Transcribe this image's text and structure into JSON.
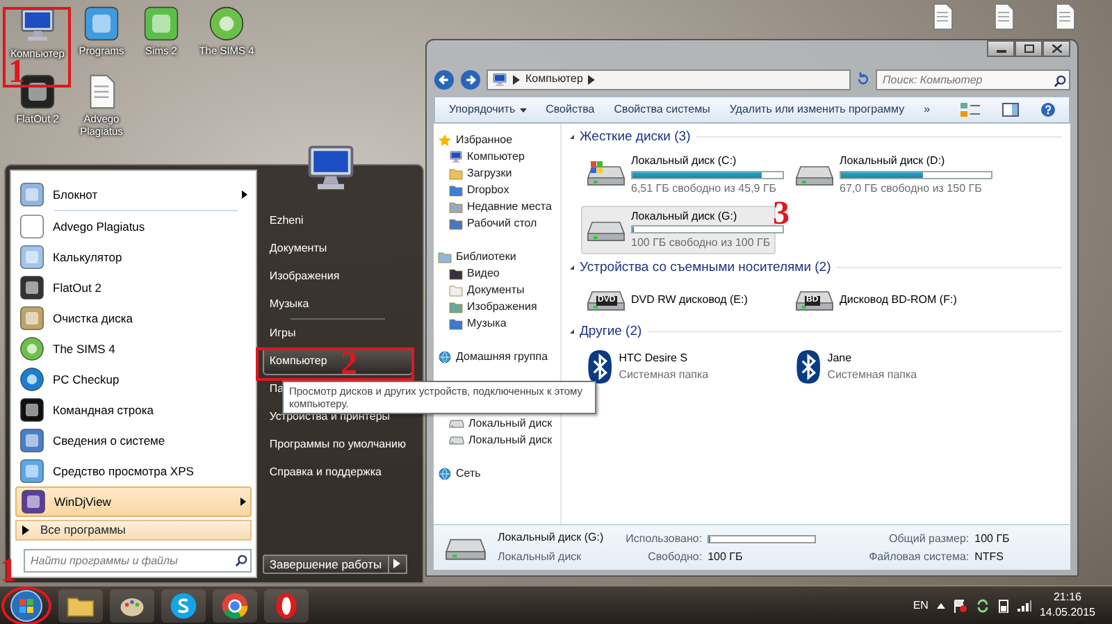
{
  "desktop_icons": [
    {
      "label": "Компьютер"
    },
    {
      "label": "Programs"
    },
    {
      "label": "Sims 2"
    },
    {
      "label": "The SIMS 4"
    },
    {
      "label": "FlatOut 2"
    },
    {
      "label": "Advego Plagiatus"
    }
  ],
  "annotations": [
    {
      "label": "1"
    },
    {
      "label": "1"
    },
    {
      "label": "2"
    },
    {
      "label": "3"
    }
  ],
  "start_menu": {
    "programs": [
      {
        "label": "Блокнот",
        "submenu": true,
        "selected": false
      },
      {
        "label": "Advego Plagiatus",
        "submenu": false,
        "selected": false
      },
      {
        "label": "Калькулятор",
        "submenu": false,
        "selected": false
      },
      {
        "label": "FlatOut 2",
        "submenu": false,
        "selected": false
      },
      {
        "label": "Очистка диска",
        "submenu": false,
        "selected": false
      },
      {
        "label": "The SIMS 4",
        "submenu": false,
        "selected": false
      },
      {
        "label": "PC Checkup",
        "submenu": false,
        "selected": false
      },
      {
        "label": "Командная строка",
        "submenu": false,
        "selected": false
      },
      {
        "label": "Сведения о системе",
        "submenu": false,
        "selected": false
      },
      {
        "label": "Средство просмотра XPS",
        "submenu": false,
        "selected": false
      },
      {
        "label": "WinDjView",
        "submenu": true,
        "selected": true
      }
    ],
    "all_programs": "Все программы",
    "search": {
      "placeholder": "Найти программы и файлы"
    },
    "places": [
      {
        "label": "Ezheni",
        "selected": false
      },
      {
        "label": "Документы",
        "selected": false
      },
      {
        "label": "Изображения",
        "selected": false
      },
      {
        "label": "Музыка",
        "selected": false
      },
      {
        "label": "Игры",
        "selected": false
      },
      {
        "label": "Компьютер",
        "selected": true
      },
      {
        "label": "Па",
        "selected": false
      },
      {
        "label": "Устройства и принтеры",
        "selected": false
      },
      {
        "label": "Программы по умолчанию",
        "selected": false
      },
      {
        "label": "Справка и поддержка",
        "selected": false
      }
    ],
    "shutdown": "Завершение работы"
  },
  "tooltip": "Просмотр дисков и других устройств, подключенных к этому компьютеру.",
  "explorer": {
    "breadcrumb": "Компьютер",
    "search": {
      "placeholder": "Поиск: Компьютер"
    },
    "toolbar": [
      {
        "label": "Упорядочить",
        "dropdown": true
      },
      {
        "label": "Свойства",
        "dropdown": false
      },
      {
        "label": "Свойства системы",
        "dropdown": false
      },
      {
        "label": "Удалить или изменить программу",
        "dropdown": false
      },
      {
        "label": "»",
        "dropdown": false
      }
    ],
    "nav": [
      {
        "label": "Избранное",
        "children": [
          {
            "label": "Компьютер"
          },
          {
            "label": "Загрузки"
          },
          {
            "label": "Dropbox"
          },
          {
            "label": "Недавние места"
          },
          {
            "label": "Рабочий стол"
          }
        ]
      },
      {
        "label": "Библиотеки",
        "children": [
          {
            "label": "Видео"
          },
          {
            "label": "Документы"
          },
          {
            "label": "Изображения"
          },
          {
            "label": "Музыка"
          }
        ]
      },
      {
        "label": "Домашняя группа"
      },
      {
        "children": [
          {
            "label": "Локальный диск"
          },
          {
            "label": "Локальный диск"
          }
        ]
      },
      {
        "label": "Сеть"
      }
    ],
    "sections": [
      {
        "title": "Жесткие диски (3)",
        "items": [
          {
            "kind": "disk",
            "name": "Локальный диск (C:)",
            "level": 0.86,
            "reading": "6,51 ГБ свободно из 45,9 ГБ",
            "selected": false
          },
          {
            "kind": "disk",
            "name": "Локальный диск (D:)",
            "level": 0.55,
            "reading": "67,0 ГБ свободно из 150 ГБ",
            "selected": false
          },
          {
            "kind": "disk",
            "name": "Локальный диск (G:)",
            "level": 0,
            "reading": "100 ГБ свободно из 100 ГБ",
            "selected": true
          }
        ]
      },
      {
        "title": "Устройства со съемными носителями (2)",
        "items": [
          {
            "kind": "optical",
            "name": "DVD RW дисковод (E:)",
            "badge": "DVD",
            "selected": false
          },
          {
            "kind": "optical",
            "name": "Дисковод BD-ROM (F:)",
            "badge": "BD",
            "selected": false
          }
        ]
      },
      {
        "title": "Другие (2)",
        "items": [
          {
            "kind": "bluetooth",
            "name": "HTC Desire S",
            "subtitle": "Системная папка",
            "selected": false
          },
          {
            "kind": "bluetooth",
            "name": "Jane",
            "subtitle": "Системная папка",
            "selected": false
          }
        ]
      }
    ],
    "details": {
      "name": "Локальный диск (G:)",
      "type": "Локальный диск",
      "usage": {
        "label": "Использовано:",
        "level": 0
      },
      "fields": [
        {
          "label": "Свободно:",
          "value": "100 ГБ"
        },
        {
          "label": "Общий размер:",
          "value": "100 ГБ"
        },
        {
          "label": "Файловая система:",
          "value": "NTFS"
        }
      ]
    }
  },
  "taskbar": {
    "language": "EN",
    "time": "21:16",
    "date": "14.05.2015"
  }
}
